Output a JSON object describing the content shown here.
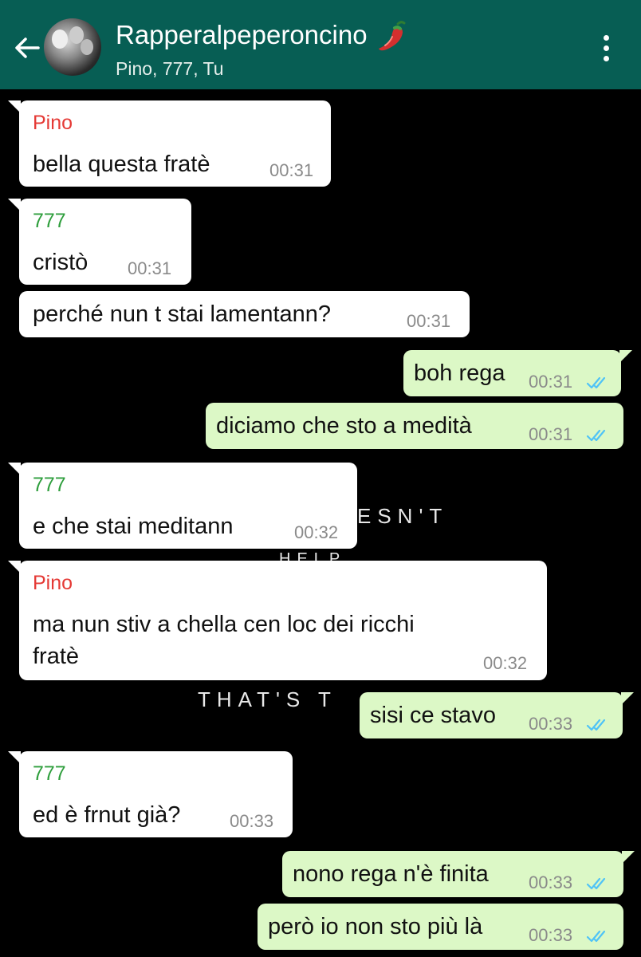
{
  "header": {
    "back_icon": "arrow-left-icon",
    "title": "Rapperalpeperoncino",
    "title_emoji_icon": "hot-pepper-icon",
    "members": "Pino, 777, Tu",
    "menu_icon": "more-vertical-icon",
    "color": "#075e54"
  },
  "background": {
    "lines": [
      "ESN'T",
      "HELP",
      "THAT'S T"
    ]
  },
  "colors": {
    "incoming": "#ffffff",
    "outgoing": "#dcf8c6",
    "pino": "#e53935",
    "seven": "#2e9e3c",
    "read_ticks": "#4fc3f7"
  },
  "messages": [
    {
      "sender": "Pino",
      "text": "bella questa fratè",
      "time": "00:31"
    },
    {
      "sender": "777",
      "text": "cristò",
      "time": "00:31"
    },
    {
      "text": "perché nun t stai lamentann?",
      "time": "00:31"
    },
    {
      "text": "boh rega",
      "time": "00:31"
    },
    {
      "text": "diciamo che sto a medità",
      "time": "00:31"
    },
    {
      "sender": "777",
      "text": "e che stai meditann",
      "time": "00:32"
    },
    {
      "sender": "Pino",
      "text_line1": "ma nun stiv a chella cen loc dei ricchi",
      "text_line2": "fratè",
      "time": "00:32"
    },
    {
      "text": "sisi ce stavo",
      "time": "00:33"
    },
    {
      "sender": "777",
      "text": "ed è frnut già?",
      "time": "00:33"
    },
    {
      "text": "nono rega n'è finita",
      "time": "00:33"
    },
    {
      "text": "però io non sto più là",
      "time": "00:33"
    }
  ]
}
